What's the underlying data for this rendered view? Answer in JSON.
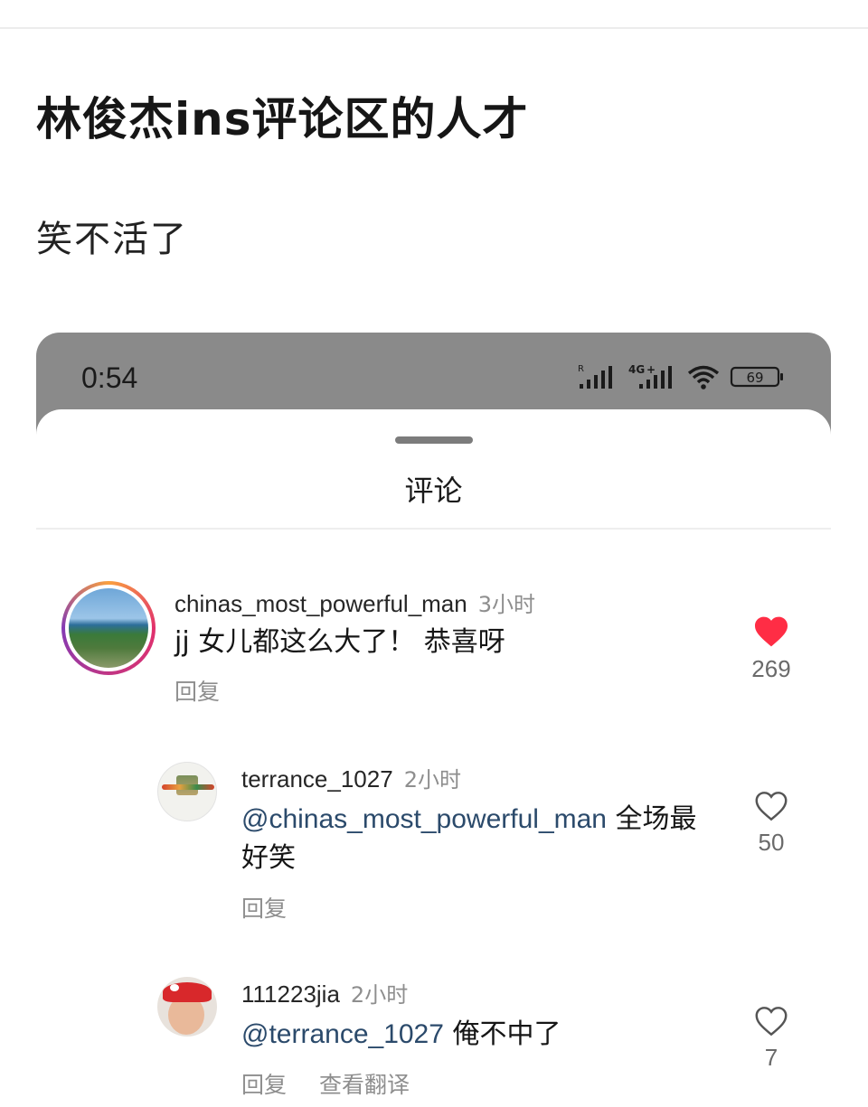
{
  "post": {
    "title": "林俊杰ins评论区的人才",
    "body": "笑不活了"
  },
  "phone": {
    "time": "0:54",
    "battery": "69",
    "network": "4G",
    "roaming": "R"
  },
  "sheet": {
    "title": "评论"
  },
  "comments": [
    {
      "username": "chinas_most_powerful_man",
      "time_ago": "3小时",
      "text": "jj 女儿都这么大了！ 恭喜呀",
      "reply_label": "回复",
      "likes": "269",
      "liked": true
    },
    {
      "username": "terrance_1027",
      "time_ago": "2小时",
      "mention": "@chinas_most_powerful_man",
      "text": " 全场最好笑",
      "reply_label": "回复",
      "likes": "50",
      "liked": false
    },
    {
      "username": "111223jia",
      "time_ago": "2小时",
      "mention": "@terrance_1027",
      "text": " 俺不中了",
      "reply_label": "回复",
      "translate_label": "查看翻译",
      "likes": "7",
      "liked": false
    }
  ],
  "colors": {
    "like_active": "#ff2d45",
    "mention": "#2b4a6b",
    "muted": "#8e8e8e",
    "status_bar": "#8a8a8a"
  },
  "icons": [
    "heart-filled-icon",
    "heart-outline-icon",
    "signal-icon",
    "wifi-icon",
    "battery-icon"
  ]
}
